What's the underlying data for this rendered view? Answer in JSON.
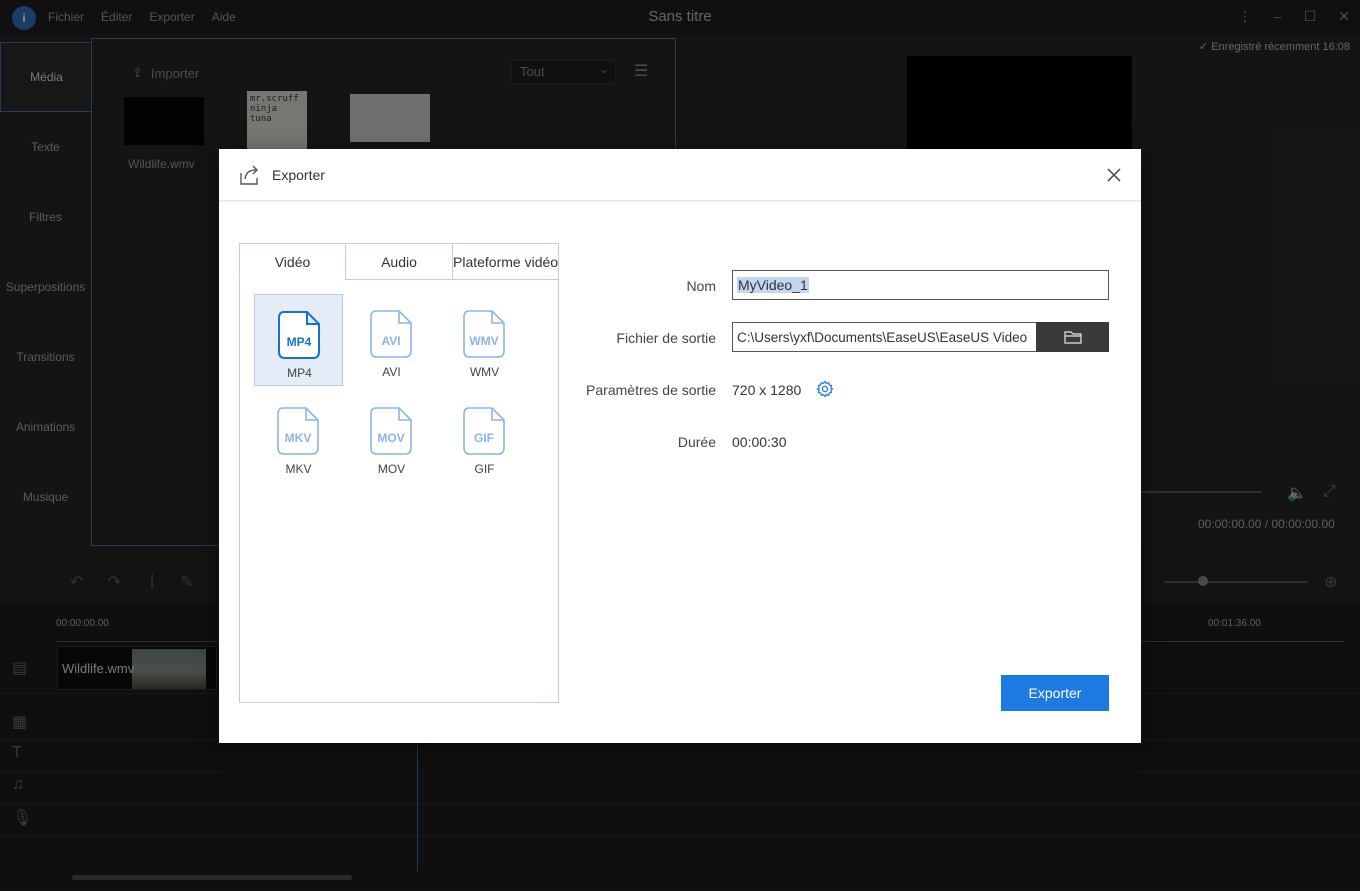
{
  "app": {
    "title": "Sans titre",
    "logo": "i",
    "menu": [
      "Fichier",
      "Éditer",
      "Exporter",
      "Aide"
    ],
    "nav": [
      "Média",
      "Texte",
      "Filtres",
      "Superpositions",
      "Transitions",
      "Animations",
      "Musique"
    ],
    "import_label": "Importer",
    "filter_value": "Tout",
    "media_items": [
      {
        "label": "Wildlife.wmv"
      }
    ],
    "thumb_text": "mr.scruff ninja tuna",
    "saved_status": "Enregistré récemment 16:08",
    "timecode": "00:00:00.00 / 00:00:00.00",
    "ruler": [
      "00:00:00.00",
      "00:01:36.00"
    ],
    "clip_name": "Wildlife.wmv"
  },
  "dialog": {
    "title": "Exporter",
    "tabs": [
      "Vidéo",
      "Audio",
      "Plateforme vidéo"
    ],
    "formats": [
      {
        "name": "MP4",
        "selected": true
      },
      {
        "name": "AVI",
        "selected": false
      },
      {
        "name": "WMV",
        "selected": false
      },
      {
        "name": "MKV",
        "selected": false
      },
      {
        "name": "MOV",
        "selected": false
      },
      {
        "name": "GIF",
        "selected": false
      }
    ],
    "fields": {
      "name_label": "Nom",
      "name_value": "MyVideo_1",
      "output_label": "Fichier de sortie",
      "output_value": "C:\\Users\\yxf\\Documents\\EaseUS\\EaseUS Video",
      "params_label": "Paramètres de sortie",
      "params_value": "720 x 1280",
      "duration_label": "Durée",
      "duration_value": "00:00:30"
    },
    "export_button": "Exporter"
  },
  "colors": {
    "accent": "#1c7ae0",
    "format_icon_selected": "#1c6fd1",
    "format_icon": "#8ab6e6",
    "selection_bg": "#e4ecf7"
  }
}
